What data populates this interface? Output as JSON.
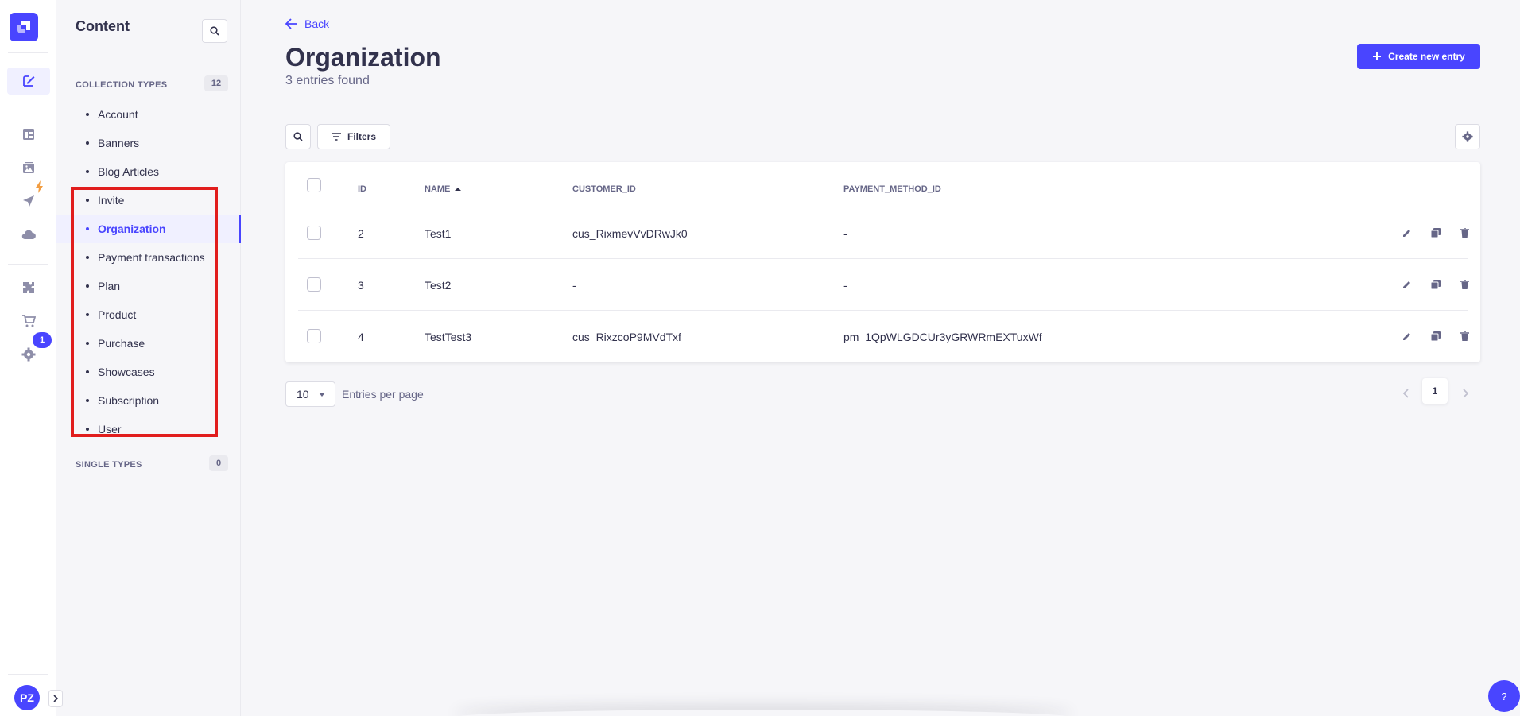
{
  "sidebar": {
    "title": "Content",
    "collection_types": {
      "label": "COLLECTION TYPES",
      "count": "12",
      "items": [
        "Account",
        "Banners",
        "Blog Articles",
        "Invite",
        "Organization",
        "Payment transactions",
        "Plan",
        "Product",
        "Purchase",
        "Showcases",
        "Subscription",
        "User"
      ],
      "active": "Organization"
    },
    "single_types": {
      "label": "SINGLE TYPES",
      "count": "0"
    }
  },
  "rail": {
    "notification_count": "1",
    "avatar_initials": "PZ",
    "icons": [
      "content-manager-icon",
      "content-type-builder-icon",
      "media-library-icon",
      "deploy-icon",
      "cloud-icon",
      "plugins-icon",
      "marketplace-icon",
      "settings-icon"
    ],
    "accent": "#4945ff",
    "lightning_color": "#f29d41"
  },
  "header": {
    "back_label": "Back",
    "title": "Organization",
    "subtitle": "3 entries found",
    "create_label": "Create new entry"
  },
  "toolbar": {
    "filters_label": "Filters"
  },
  "table": {
    "columns": {
      "id": "ID",
      "name": "NAME",
      "customer_id": "CUSTOMER_ID",
      "payment_method_id": "PAYMENT_METHOD_ID"
    },
    "rows": [
      {
        "id": "2",
        "name": "Test1",
        "customer_id": "cus_RixmevVvDRwJk0",
        "payment_method_id": "-"
      },
      {
        "id": "3",
        "name": "Test2",
        "customer_id": "-",
        "payment_method_id": "-"
      },
      {
        "id": "4",
        "name": "TestTest3",
        "customer_id": "cus_RixzcoP9MVdTxf",
        "payment_method_id": "pm_1QpWLGDCUr3yGRWRmEXTuxWf"
      }
    ]
  },
  "pagination": {
    "per_page": "10",
    "per_page_label": "Entries per page",
    "current_page": "1"
  },
  "help_label": "?"
}
